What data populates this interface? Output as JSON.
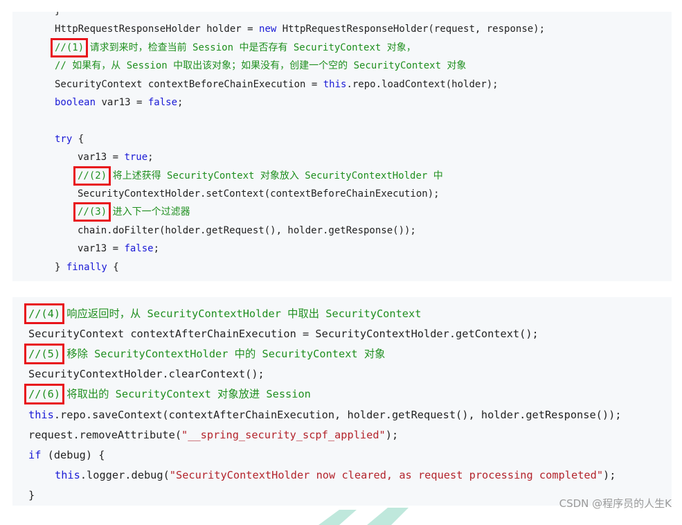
{
  "colors": {
    "keyword": "#1a1ad6",
    "comment": "#1f8f1f",
    "string": "#b3232b",
    "highlight_box": "#e8141b",
    "code_background": "#f6f8fa"
  },
  "top_block": [
    {
      "indent": 1,
      "tokens": [
        {
          "t": "}"
        }
      ]
    },
    {
      "indent": 1,
      "tokens": [
        {
          "t": "HttpRequestResponseHolder holder = "
        },
        {
          "t": "new",
          "c": "kw"
        },
        {
          "t": " HttpRequestResponseHolder(request, response);"
        }
      ]
    },
    {
      "indent": 1,
      "tokens": [
        {
          "t": "//(1)",
          "c": "cm",
          "box": true
        },
        {
          "t": " 请求到来时，检查当前 Session 中是否存有 SecurityContext 对象，",
          "c": "cm"
        }
      ]
    },
    {
      "indent": 1,
      "tokens": [
        {
          "t": "// 如果有，从 Session 中取出该对象；如果没有，创建一个空的 SecurityContext 对象",
          "c": "cm"
        }
      ]
    },
    {
      "indent": 1,
      "tokens": [
        {
          "t": "SecurityContext contextBeforeChainExecution = "
        },
        {
          "t": "this",
          "c": "kw"
        },
        {
          "t": ".repo.loadContext(holder);"
        }
      ]
    },
    {
      "indent": 1,
      "tokens": [
        {
          "t": "boolean",
          "c": "kw"
        },
        {
          "t": " var13 = "
        },
        {
          "t": "false",
          "c": "kw"
        },
        {
          "t": ";"
        }
      ]
    },
    {
      "indent": 1,
      "tokens": []
    },
    {
      "indent": 1,
      "tokens": [
        {
          "t": "try",
          "c": "kw"
        },
        {
          "t": " {"
        }
      ]
    },
    {
      "indent": 2,
      "tokens": [
        {
          "t": "var13 = "
        },
        {
          "t": "true",
          "c": "kw"
        },
        {
          "t": ";"
        }
      ]
    },
    {
      "indent": 2,
      "tokens": [
        {
          "t": "//(2)",
          "c": "cm",
          "box": true
        },
        {
          "t": " 将上述获得 SecurityContext 对象放入 SecurityContextHolder 中",
          "c": "cm"
        }
      ]
    },
    {
      "indent": 2,
      "tokens": [
        {
          "t": "SecurityContextHolder.setContext(contextBeforeChainExecution);"
        }
      ]
    },
    {
      "indent": 2,
      "tokens": [
        {
          "t": "//(3)",
          "c": "cm",
          "box": true
        },
        {
          "t": " 进入下一个过滤器",
          "c": "cm"
        }
      ]
    },
    {
      "indent": 2,
      "tokens": [
        {
          "t": "chain.doFilter(holder.getRequest(), holder.getResponse());"
        }
      ]
    },
    {
      "indent": 2,
      "tokens": [
        {
          "t": "var13 = "
        },
        {
          "t": "false",
          "c": "kw"
        },
        {
          "t": ";"
        }
      ]
    },
    {
      "indent": 1,
      "tokens": [
        {
          "t": "} "
        },
        {
          "t": "finally",
          "c": "kw"
        },
        {
          "t": " {"
        }
      ]
    }
  ],
  "bottom_block": [
    {
      "indent": 0,
      "tokens": [
        {
          "t": "//(4)",
          "c": "cm",
          "box": true
        },
        {
          "t": " 响应返回时，从 SecurityContextHolder 中取出 SecurityContext",
          "c": "cm"
        }
      ]
    },
    {
      "indent": 0,
      "tokens": [
        {
          "t": "SecurityContext contextAfterChainExecution = SecurityContextHolder.getContext();"
        }
      ]
    },
    {
      "indent": 0,
      "tokens": [
        {
          "t": "//(5)",
          "c": "cm",
          "box": true
        },
        {
          "t": " 移除 SecurityContextHolder 中的 SecurityContext 对象",
          "c": "cm"
        }
      ]
    },
    {
      "indent": 0,
      "tokens": [
        {
          "t": "SecurityContextHolder.clearContext();"
        }
      ]
    },
    {
      "indent": 0,
      "tokens": [
        {
          "t": "//(6)",
          "c": "cm",
          "box": true
        },
        {
          "t": " 将取出的 SecurityContext 对象放进 Session",
          "c": "cm"
        }
      ]
    },
    {
      "indent": 0,
      "tokens": [
        {
          "t": "this",
          "c": "kw"
        },
        {
          "t": ".repo.saveContext(contextAfterChainExecution, holder.getRequest(), holder.getResponse());"
        }
      ]
    },
    {
      "indent": 0,
      "tokens": [
        {
          "t": "request.removeAttribute("
        },
        {
          "t": "\"__spring_security_scpf_applied\"",
          "c": "str"
        },
        {
          "t": ");"
        }
      ]
    },
    {
      "indent": 0,
      "tokens": [
        {
          "t": "if",
          "c": "kw"
        },
        {
          "t": " (debug) {"
        }
      ]
    },
    {
      "indent": 1,
      "tokens": [
        {
          "t": "this",
          "c": "kw"
        },
        {
          "t": ".logger.debug("
        },
        {
          "t": "\"SecurityContextHolder now cleared, as request processing completed\"",
          "c": "str"
        },
        {
          "t": ");"
        }
      ]
    },
    {
      "indent": 0,
      "tokens": [
        {
          "t": "}"
        }
      ]
    }
  ],
  "watermark": "CSDN @程序员的人生K"
}
